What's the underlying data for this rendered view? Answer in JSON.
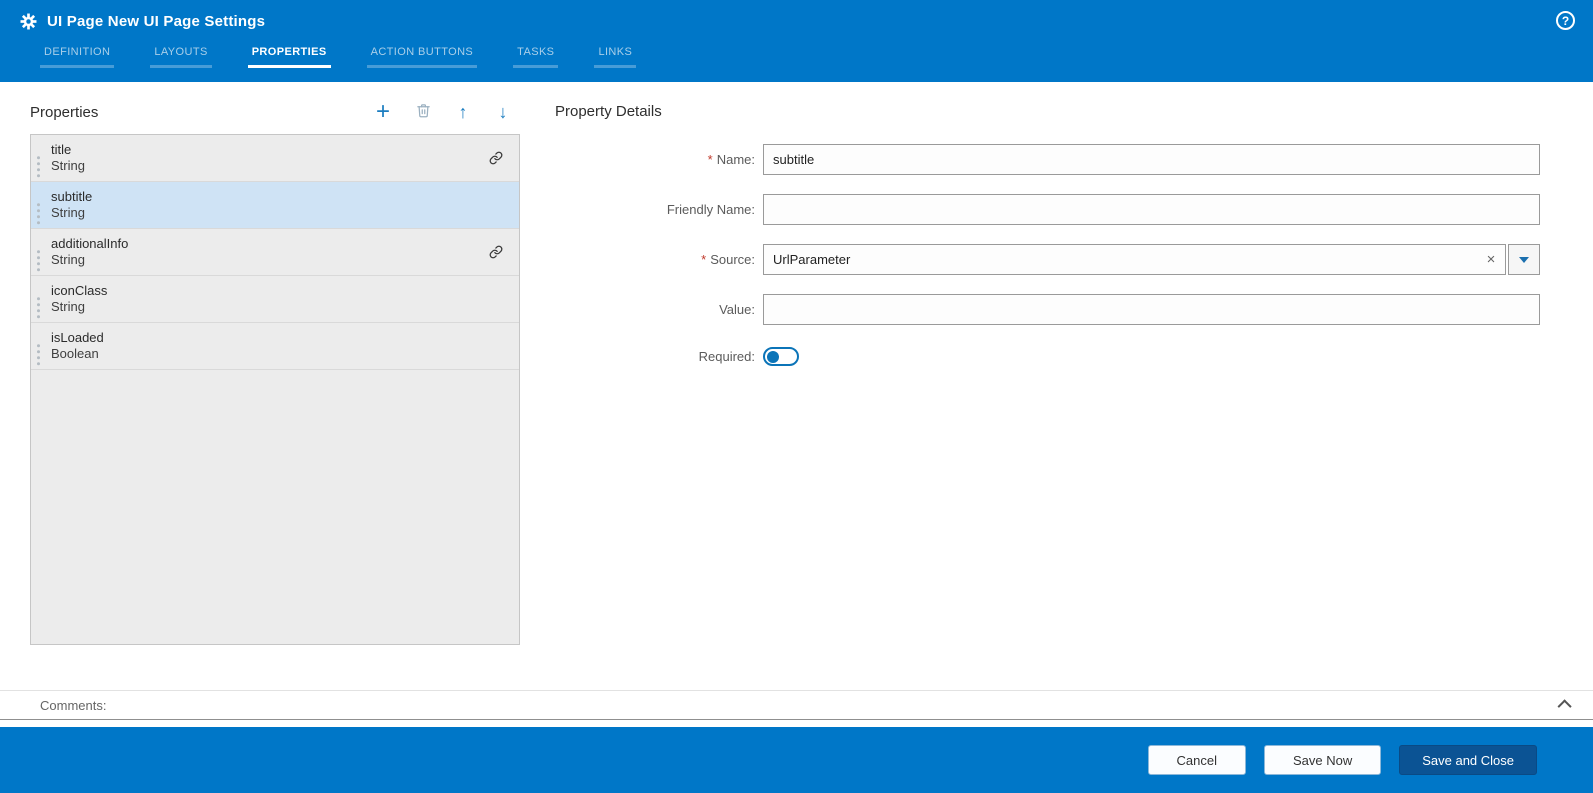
{
  "header": {
    "title": "UI Page New UI Page Settings"
  },
  "tabs": [
    {
      "label": "DEFINITION",
      "active": false
    },
    {
      "label": "LAYOUTS",
      "active": false
    },
    {
      "label": "PROPERTIES",
      "active": true
    },
    {
      "label": "ACTION BUTTONS",
      "active": false
    },
    {
      "label": "TASKS",
      "active": false
    },
    {
      "label": "LINKS",
      "active": false
    }
  ],
  "properties_panel": {
    "title": "Properties",
    "items": [
      {
        "name": "title",
        "type": "String",
        "linked": true,
        "selected": false
      },
      {
        "name": "subtitle",
        "type": "String",
        "linked": false,
        "selected": true
      },
      {
        "name": "additionalInfo",
        "type": "String",
        "linked": true,
        "selected": false
      },
      {
        "name": "iconClass",
        "type": "String",
        "linked": false,
        "selected": false
      },
      {
        "name": "isLoaded",
        "type": "Boolean",
        "linked": false,
        "selected": false
      }
    ]
  },
  "details": {
    "title": "Property Details",
    "required_marker": "*",
    "fields": {
      "name": {
        "label": "Name:",
        "required": true,
        "value": "subtitle"
      },
      "friendly_name": {
        "label": "Friendly Name:",
        "required": false,
        "value": ""
      },
      "source": {
        "label": "Source:",
        "required": true,
        "value": "UrlParameter"
      },
      "value": {
        "label": "Value:",
        "required": false,
        "value": ""
      },
      "required_toggle": {
        "label": "Required:",
        "on": false
      }
    }
  },
  "comments": {
    "label": "Comments:"
  },
  "footer": {
    "buttons": [
      {
        "label": "Cancel",
        "primary": false
      },
      {
        "label": "Save Now",
        "primary": false
      },
      {
        "label": "Save and Close",
        "primary": true
      }
    ]
  },
  "icons": {
    "gear": "gear-icon",
    "help": "?",
    "add": "+",
    "delete": "trash-icon",
    "move_up": "↑",
    "move_down": "↓",
    "link": "link-icon",
    "clear": "×",
    "dropdown": "chevron-down-icon",
    "collapse": "chevron-up-icon",
    "drag": "drag-handle-icon"
  },
  "colors": {
    "header_blue": "#0077c8",
    "primary_button": "#0b5394",
    "selected_item": "#cfe3f5",
    "list_background": "#ececec",
    "required_asterisk": "#c0392b",
    "accent_icon_blue": "#1b7dc0"
  }
}
